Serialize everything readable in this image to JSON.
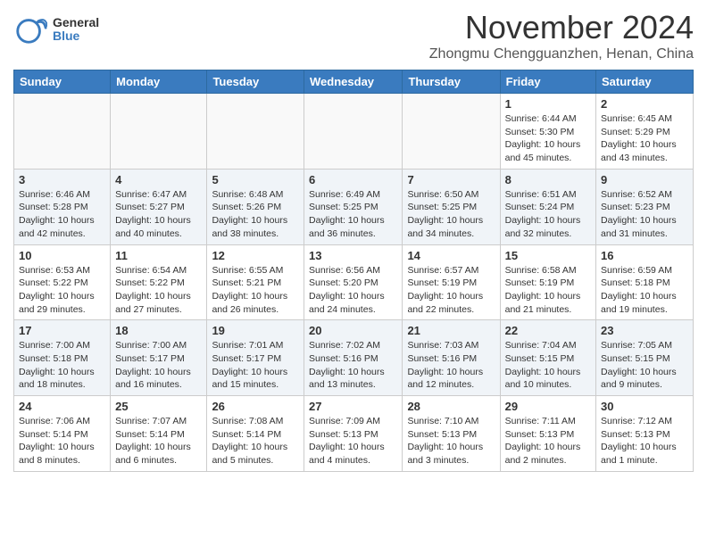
{
  "header": {
    "logo_general": "General",
    "logo_blue": "Blue",
    "month_title": "November 2024",
    "location": "Zhongmu Chengguanzhen, Henan, China"
  },
  "days_of_week": [
    "Sunday",
    "Monday",
    "Tuesday",
    "Wednesday",
    "Thursday",
    "Friday",
    "Saturday"
  ],
  "weeks": [
    [
      {
        "day": "",
        "info": ""
      },
      {
        "day": "",
        "info": ""
      },
      {
        "day": "",
        "info": ""
      },
      {
        "day": "",
        "info": ""
      },
      {
        "day": "",
        "info": ""
      },
      {
        "day": "1",
        "info": "Sunrise: 6:44 AM\nSunset: 5:30 PM\nDaylight: 10 hours and 45 minutes."
      },
      {
        "day": "2",
        "info": "Sunrise: 6:45 AM\nSunset: 5:29 PM\nDaylight: 10 hours and 43 minutes."
      }
    ],
    [
      {
        "day": "3",
        "info": "Sunrise: 6:46 AM\nSunset: 5:28 PM\nDaylight: 10 hours and 42 minutes."
      },
      {
        "day": "4",
        "info": "Sunrise: 6:47 AM\nSunset: 5:27 PM\nDaylight: 10 hours and 40 minutes."
      },
      {
        "day": "5",
        "info": "Sunrise: 6:48 AM\nSunset: 5:26 PM\nDaylight: 10 hours and 38 minutes."
      },
      {
        "day": "6",
        "info": "Sunrise: 6:49 AM\nSunset: 5:25 PM\nDaylight: 10 hours and 36 minutes."
      },
      {
        "day": "7",
        "info": "Sunrise: 6:50 AM\nSunset: 5:25 PM\nDaylight: 10 hours and 34 minutes."
      },
      {
        "day": "8",
        "info": "Sunrise: 6:51 AM\nSunset: 5:24 PM\nDaylight: 10 hours and 32 minutes."
      },
      {
        "day": "9",
        "info": "Sunrise: 6:52 AM\nSunset: 5:23 PM\nDaylight: 10 hours and 31 minutes."
      }
    ],
    [
      {
        "day": "10",
        "info": "Sunrise: 6:53 AM\nSunset: 5:22 PM\nDaylight: 10 hours and 29 minutes."
      },
      {
        "day": "11",
        "info": "Sunrise: 6:54 AM\nSunset: 5:22 PM\nDaylight: 10 hours and 27 minutes."
      },
      {
        "day": "12",
        "info": "Sunrise: 6:55 AM\nSunset: 5:21 PM\nDaylight: 10 hours and 26 minutes."
      },
      {
        "day": "13",
        "info": "Sunrise: 6:56 AM\nSunset: 5:20 PM\nDaylight: 10 hours and 24 minutes."
      },
      {
        "day": "14",
        "info": "Sunrise: 6:57 AM\nSunset: 5:19 PM\nDaylight: 10 hours and 22 minutes."
      },
      {
        "day": "15",
        "info": "Sunrise: 6:58 AM\nSunset: 5:19 PM\nDaylight: 10 hours and 21 minutes."
      },
      {
        "day": "16",
        "info": "Sunrise: 6:59 AM\nSunset: 5:18 PM\nDaylight: 10 hours and 19 minutes."
      }
    ],
    [
      {
        "day": "17",
        "info": "Sunrise: 7:00 AM\nSunset: 5:18 PM\nDaylight: 10 hours and 18 minutes."
      },
      {
        "day": "18",
        "info": "Sunrise: 7:00 AM\nSunset: 5:17 PM\nDaylight: 10 hours and 16 minutes."
      },
      {
        "day": "19",
        "info": "Sunrise: 7:01 AM\nSunset: 5:17 PM\nDaylight: 10 hours and 15 minutes."
      },
      {
        "day": "20",
        "info": "Sunrise: 7:02 AM\nSunset: 5:16 PM\nDaylight: 10 hours and 13 minutes."
      },
      {
        "day": "21",
        "info": "Sunrise: 7:03 AM\nSunset: 5:16 PM\nDaylight: 10 hours and 12 minutes."
      },
      {
        "day": "22",
        "info": "Sunrise: 7:04 AM\nSunset: 5:15 PM\nDaylight: 10 hours and 10 minutes."
      },
      {
        "day": "23",
        "info": "Sunrise: 7:05 AM\nSunset: 5:15 PM\nDaylight: 10 hours and 9 minutes."
      }
    ],
    [
      {
        "day": "24",
        "info": "Sunrise: 7:06 AM\nSunset: 5:14 PM\nDaylight: 10 hours and 8 minutes."
      },
      {
        "day": "25",
        "info": "Sunrise: 7:07 AM\nSunset: 5:14 PM\nDaylight: 10 hours and 6 minutes."
      },
      {
        "day": "26",
        "info": "Sunrise: 7:08 AM\nSunset: 5:14 PM\nDaylight: 10 hours and 5 minutes."
      },
      {
        "day": "27",
        "info": "Sunrise: 7:09 AM\nSunset: 5:13 PM\nDaylight: 10 hours and 4 minutes."
      },
      {
        "day": "28",
        "info": "Sunrise: 7:10 AM\nSunset: 5:13 PM\nDaylight: 10 hours and 3 minutes."
      },
      {
        "day": "29",
        "info": "Sunrise: 7:11 AM\nSunset: 5:13 PM\nDaylight: 10 hours and 2 minutes."
      },
      {
        "day": "30",
        "info": "Sunrise: 7:12 AM\nSunset: 5:13 PM\nDaylight: 10 hours and 1 minute."
      }
    ]
  ]
}
